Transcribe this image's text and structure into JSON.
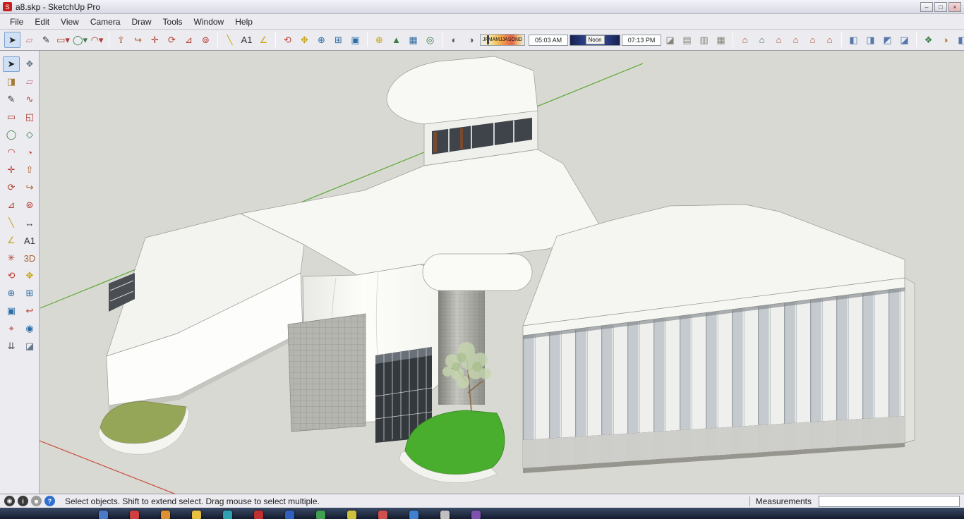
{
  "window": {
    "title": "a8.skp - SketchUp Pro",
    "app_icon_glyph": "S",
    "controls": {
      "minimize": "–",
      "maximize": "□",
      "close": "×"
    }
  },
  "menu": {
    "items": [
      {
        "n": "menu-file",
        "label": "File"
      },
      {
        "n": "menu-edit",
        "label": "Edit"
      },
      {
        "n": "menu-view",
        "label": "View"
      },
      {
        "n": "menu-camera",
        "label": "Camera"
      },
      {
        "n": "menu-draw",
        "label": "Draw"
      },
      {
        "n": "menu-tools",
        "label": "Tools"
      },
      {
        "n": "menu-window",
        "label": "Window"
      },
      {
        "n": "menu-help",
        "label": "Help"
      }
    ]
  },
  "toolbar": {
    "groups": {
      "g1": [
        {
          "n": "select-tool-icon",
          "g": "➤",
          "c": "#222222"
        },
        {
          "n": "eraser-tool-icon",
          "g": "▱",
          "c": "#cc7788"
        },
        {
          "n": "line-tool-icon",
          "g": "✎",
          "c": "#333333"
        },
        {
          "n": "rectangle-tool-icon",
          "g": "▭▾",
          "c": "#b03a2e"
        },
        {
          "n": "circle-tool-icon",
          "g": "◯▾",
          "c": "#3a7d44"
        },
        {
          "n": "arc-tool-icon",
          "g": "◠▾",
          "c": "#b03a2e"
        }
      ],
      "g2": [
        {
          "n": "push-pull-tool-icon",
          "g": "⇧",
          "c": "#b06030"
        },
        {
          "n": "follow-me-tool-icon",
          "g": "↪",
          "c": "#b06030"
        },
        {
          "n": "move-tool-icon",
          "g": "✛",
          "c": "#b03a2e"
        },
        {
          "n": "rotate-tool-icon",
          "g": "⟳",
          "c": "#b03a2e"
        },
        {
          "n": "scale-tool-icon",
          "g": "⊿",
          "c": "#b03a2e"
        },
        {
          "n": "offset-tool-icon",
          "g": "⊚",
          "c": "#b03a2e"
        }
      ],
      "g3": [
        {
          "n": "tape-measure-tool-icon",
          "g": "╲",
          "c": "#c8a415"
        },
        {
          "n": "text-tool-icon",
          "g": "A1",
          "c": "#333333"
        },
        {
          "n": "protractor-tool-icon",
          "g": "∠",
          "c": "#c8a415"
        }
      ],
      "g4": [
        {
          "n": "orbit-tool-icon",
          "g": "⟲",
          "c": "#c23b2e"
        },
        {
          "n": "pan-tool-icon",
          "g": "✥",
          "c": "#c8a415"
        },
        {
          "n": "zoom-tool-icon",
          "g": "⊕",
          "c": "#2e6da4"
        },
        {
          "n": "zoom-window-tool-icon",
          "g": "⊞",
          "c": "#2e6da4"
        },
        {
          "n": "zoom-extents-tool-icon",
          "g": "▣",
          "c": "#2e6da4"
        }
      ],
      "g5": [
        {
          "n": "add-location-icon",
          "g": "⊕",
          "c": "#c8a415"
        },
        {
          "n": "toggle-terrain-icon",
          "g": "▲",
          "c": "#3a7d44"
        },
        {
          "n": "photo-textures-icon",
          "g": "▦",
          "c": "#2e6da4"
        },
        {
          "n": "preview-google-earth-icon",
          "g": "◎",
          "c": "#3a7d44"
        }
      ],
      "g6": [
        {
          "n": "shadow-settings-icon",
          "g": "◐",
          "c": "#555555"
        },
        {
          "n": "shadow-toggle-icon",
          "g": "◑",
          "c": "#555555"
        }
      ],
      "g8": [
        {
          "n": "section-plane-icon",
          "g": "◪",
          "c": "#88837a"
        },
        {
          "n": "display-section-planes-icon",
          "g": "▤",
          "c": "#88837a"
        },
        {
          "n": "display-section-cuts-icon",
          "g": "▥",
          "c": "#88837a"
        },
        {
          "n": "display-section-fill-icon",
          "g": "▦",
          "c": "#88837a"
        }
      ],
      "g9": [
        {
          "n": "view-iso-icon",
          "g": "⌂",
          "c": "#b05030"
        },
        {
          "n": "view-top-icon",
          "g": "⌂",
          "c": "#3a7d44"
        },
        {
          "n": "view-front-icon",
          "g": "⌂",
          "c": "#b05030"
        },
        {
          "n": "view-right-icon",
          "g": "⌂",
          "c": "#b05030"
        },
        {
          "n": "view-back-icon",
          "g": "⌂",
          "c": "#b05030"
        },
        {
          "n": "view-left-icon",
          "g": "⌂",
          "c": "#b05030"
        }
      ],
      "g10": [
        {
          "n": "style-xray-icon",
          "g": "◧",
          "c": "#5577aa"
        },
        {
          "n": "style-wireframe-icon",
          "g": "◨",
          "c": "#5577aa"
        },
        {
          "n": "style-hidden-line-icon",
          "g": "◩",
          "c": "#5577aa"
        },
        {
          "n": "style-shaded-icon",
          "g": "◪",
          "c": "#5577aa"
        }
      ],
      "g11": [
        {
          "n": "components-panel-icon",
          "g": "❖",
          "c": "#3a7d44"
        },
        {
          "n": "materials-panel-icon",
          "g": "◑",
          "c": "#a67c3a"
        },
        {
          "n": "styles-panel-icon",
          "g": "◧",
          "c": "#5577aa"
        }
      ]
    },
    "shadows": {
      "months": [
        {
          "n": "month-jan",
          "label": "J"
        },
        {
          "n": "month-feb",
          "label": "F"
        },
        {
          "n": "month-mar",
          "label": "M"
        },
        {
          "n": "month-apr",
          "label": "A"
        },
        {
          "n": "month-may",
          "label": "M"
        },
        {
          "n": "month-jun",
          "label": "J"
        },
        {
          "n": "month-jul",
          "label": "J"
        },
        {
          "n": "month-aug",
          "label": "A"
        },
        {
          "n": "month-sep",
          "label": "S"
        },
        {
          "n": "month-oct",
          "label": "O"
        },
        {
          "n": "month-nov",
          "label": "N"
        },
        {
          "n": "month-dec",
          "label": "D"
        }
      ],
      "time_start": "05:03 AM",
      "time_mid": "Noon",
      "time_end": "07:13 PM"
    }
  },
  "left_toolbar": {
    "tools": [
      {
        "n": "select-tool-icon",
        "g": "➤",
        "c": "#222222"
      },
      {
        "n": "make-component-icon",
        "g": "❖",
        "c": "#667788"
      },
      {
        "n": "paint-bucket-icon",
        "g": "◨",
        "c": "#a67c3a"
      },
      {
        "n": "eraser-tool-icon",
        "g": "▱",
        "c": "#cc7788"
      },
      {
        "n": "line-tool-icon",
        "g": "✎",
        "c": "#333333"
      },
      {
        "n": "freehand-tool-icon",
        "g": "∿",
        "c": "#b03a2e"
      },
      {
        "n": "rectangle-tool-icon",
        "g": "▭",
        "c": "#b03a2e"
      },
      {
        "n": "rotated-rectangle-icon",
        "g": "◱",
        "c": "#b03a2e"
      },
      {
        "n": "circle-tool-icon",
        "g": "◯",
        "c": "#3a7d44"
      },
      {
        "n": "polygon-tool-icon",
        "g": "◇",
        "c": "#3a7d44"
      },
      {
        "n": "arc-tool-icon",
        "g": "◠",
        "c": "#b03a2e"
      },
      {
        "n": "pie-tool-icon",
        "g": "◔",
        "c": "#b03a2e"
      },
      {
        "n": "move-tool-icon",
        "g": "✛",
        "c": "#b03a2e"
      },
      {
        "n": "push-pull-tool-icon",
        "g": "⇧",
        "c": "#b06030"
      },
      {
        "n": "rotate-tool-icon",
        "g": "⟳",
        "c": "#b03a2e"
      },
      {
        "n": "follow-me-tool-icon",
        "g": "↪",
        "c": "#b06030"
      },
      {
        "n": "scale-tool-icon",
        "g": "⊿",
        "c": "#b03a2e"
      },
      {
        "n": "offset-tool-icon",
        "g": "⊚",
        "c": "#b03a2e"
      },
      {
        "n": "tape-measure-icon",
        "g": "╲",
        "c": "#c8a415"
      },
      {
        "n": "dimension-tool-icon",
        "g": "↔",
        "c": "#333333"
      },
      {
        "n": "protractor-tool-icon",
        "g": "∠",
        "c": "#c8a415"
      },
      {
        "n": "text-tool-icon",
        "g": "A1",
        "c": "#333333"
      },
      {
        "n": "axes-tool-icon",
        "g": "✳",
        "c": "#b03a2e"
      },
      {
        "n": "3d-text-tool-icon",
        "g": "3D",
        "c": "#b06030"
      },
      {
        "n": "orbit-tool-icon",
        "g": "⟲",
        "c": "#c23b2e"
      },
      {
        "n": "pan-tool-icon",
        "g": "✥",
        "c": "#c8a415"
      },
      {
        "n": "zoom-tool-icon",
        "g": "⊕",
        "c": "#2e6da4"
      },
      {
        "n": "zoom-window-icon",
        "g": "⊞",
        "c": "#2e6da4"
      },
      {
        "n": "zoom-extents-icon",
        "g": "▣",
        "c": "#2e6da4"
      },
      {
        "n": "previous-view-icon",
        "g": "↩",
        "c": "#c23b2e"
      },
      {
        "n": "position-camera-icon",
        "g": "⌖",
        "c": "#b03a2e"
      },
      {
        "n": "look-around-icon",
        "g": "◉",
        "c": "#2e6da4"
      },
      {
        "n": "walk-tool-icon",
        "g": "⇊",
        "c": "#555555"
      },
      {
        "n": "section-plane-icon",
        "g": "◪",
        "c": "#667788"
      }
    ]
  },
  "canvas": {
    "axes": {
      "green": "#5aa832",
      "red": "#c84b3c"
    },
    "lawn_color": "#49ad2e",
    "building_color": "#f7f7f3"
  },
  "statusbar": {
    "icons": [
      {
        "n": "geolocation-icon",
        "g": "◉",
        "bg": "#3a3a3a",
        "c": "#ffffff"
      },
      {
        "n": "credits-icon",
        "g": "i",
        "bg": "#3a3a3a",
        "c": "#ffffff"
      },
      {
        "n": "sign-in-icon",
        "g": "☻",
        "bg": "#9a9a9a",
        "c": "#ffffff"
      },
      {
        "n": "help-icon",
        "g": "?",
        "bg": "#2f6fd0",
        "c": "#ffffff"
      }
    ],
    "hint": "Select objects. Shift to extend select. Drag mouse to select multiple.",
    "measurements_label": "Measurements",
    "measurements_value": ""
  },
  "taskbar": {
    "icons": [
      {
        "n": "taskbar-app-1",
        "c": "#4a7ac8"
      },
      {
        "n": "taskbar-app-2",
        "c": "#d04040"
      },
      {
        "n": "taskbar-app-3",
        "c": "#e09030"
      },
      {
        "n": "taskbar-app-4",
        "c": "#e8c040"
      },
      {
        "n": "taskbar-app-5",
        "c": "#30a0b0"
      },
      {
        "n": "taskbar-app-6",
        "c": "#c03030"
      },
      {
        "n": "taskbar-app-7",
        "c": "#3060c0"
      },
      {
        "n": "taskbar-app-8",
        "c": "#40a050"
      },
      {
        "n": "taskbar-app-9",
        "c": "#d0c040"
      },
      {
        "n": "taskbar-app-10",
        "c": "#d05050"
      },
      {
        "n": "taskbar-app-11",
        "c": "#4080d0"
      },
      {
        "n": "taskbar-app-12",
        "c": "#c0c0c0"
      },
      {
        "n": "taskbar-app-13",
        "c": "#8050b0"
      }
    ]
  }
}
